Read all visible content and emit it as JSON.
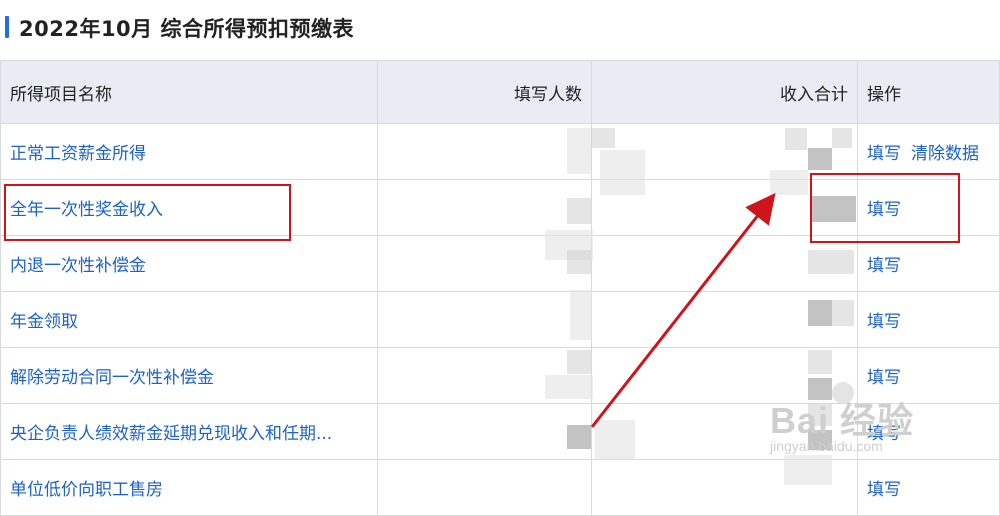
{
  "title": "2022年10月  综合所得预扣预缴表",
  "columns": {
    "name": "所得项目名称",
    "count": "填写人数",
    "income": "收入合计",
    "ops": "操作"
  },
  "rows": [
    {
      "name": "正常工资薪金所得",
      "ops": [
        "填写",
        "清除数据"
      ]
    },
    {
      "name": "全年一次性奖金收入",
      "ops": [
        "填写"
      ]
    },
    {
      "name": "内退一次性补偿金",
      "ops": [
        "填写"
      ]
    },
    {
      "name": "年金领取",
      "ops": [
        "填写"
      ]
    },
    {
      "name": "解除劳动合同一次性补偿金",
      "ops": [
        "填写"
      ]
    },
    {
      "name": "央企负责人绩效薪金延期兑现收入和任期...",
      "ops": [
        "填写"
      ]
    },
    {
      "name": "单位低价向职工售房",
      "ops": [
        "填写"
      ]
    }
  ],
  "watermark": {
    "main": "Bai 经验",
    "sub": "jingyan.baidu.com"
  },
  "colors": {
    "accent": "#1f6fe0",
    "link": "#1c62c9",
    "annotation": "#d0141c",
    "header_bg": "#e9edf3"
  }
}
